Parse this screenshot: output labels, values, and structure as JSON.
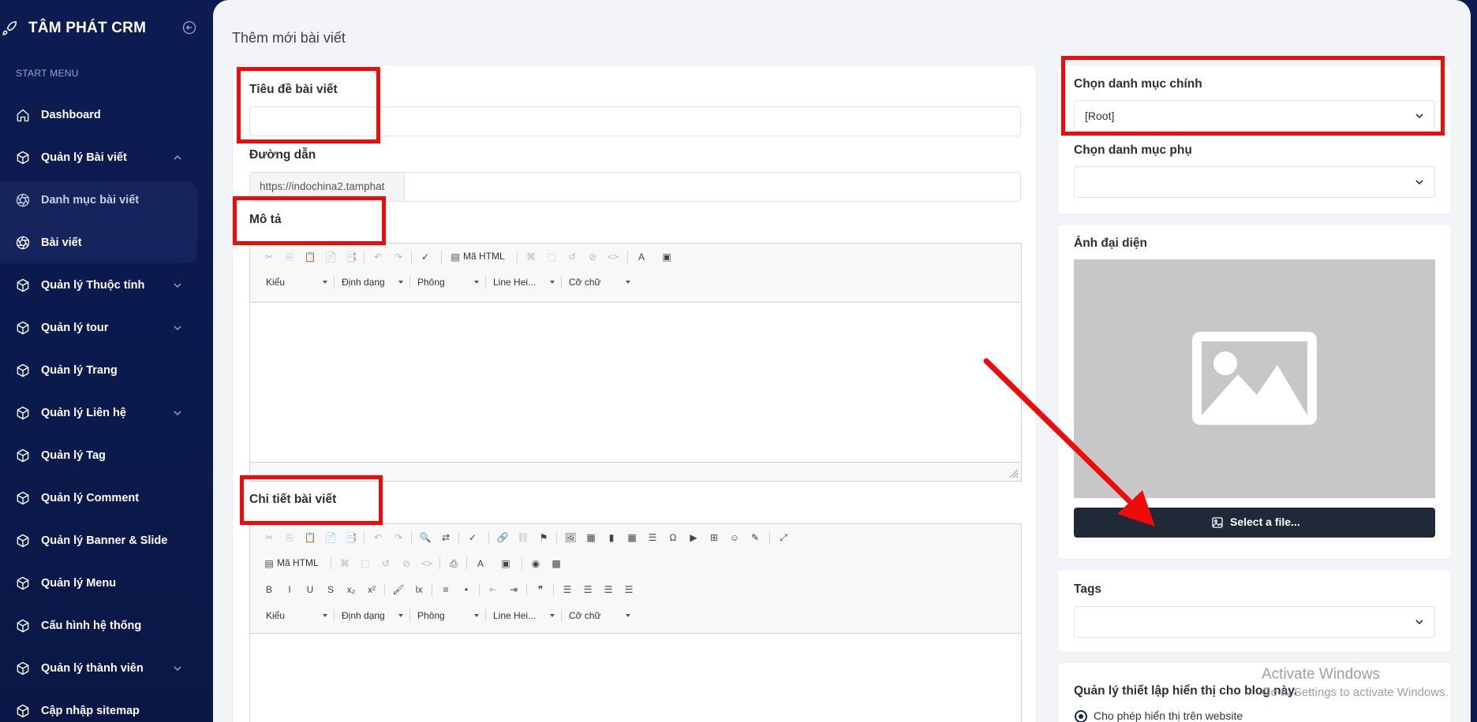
{
  "app": {
    "name": "TÂM PHÁT CRM"
  },
  "sidebar": {
    "section_label": "START MENU",
    "items": [
      {
        "label": "Dashboard",
        "icon": "home-icon",
        "has_chevron": false
      },
      {
        "label": "Quản lý Bài viết",
        "icon": "box-icon",
        "has_chevron": true,
        "expanded": true
      },
      {
        "label": "Danh mục bài viết",
        "icon": "aperture-icon",
        "sub": true
      },
      {
        "label": "Bài viết",
        "icon": "aperture-icon",
        "sub": true,
        "active": true
      },
      {
        "label": "Quản lý Thuộc tính",
        "icon": "box-icon",
        "has_chevron": true
      },
      {
        "label": "Quản lý tour",
        "icon": "box-icon",
        "has_chevron": true
      },
      {
        "label": "Quản lý Trang",
        "icon": "box-icon",
        "has_chevron": false
      },
      {
        "label": "Quản lý Liên hệ",
        "icon": "box-icon",
        "has_chevron": true
      },
      {
        "label": "Quản lý Tag",
        "icon": "box-icon",
        "has_chevron": false
      },
      {
        "label": "Quản lý Comment",
        "icon": "box-icon",
        "has_chevron": false
      },
      {
        "label": "Quản lý Banner & Slide",
        "icon": "box-icon",
        "has_chevron": false
      },
      {
        "label": "Quản lý Menu",
        "icon": "box-icon",
        "has_chevron": false
      },
      {
        "label": "Cấu hình hệ thống",
        "icon": "box-icon",
        "has_chevron": false
      },
      {
        "label": "Quản lý thành viên",
        "icon": "box-icon",
        "has_chevron": true
      },
      {
        "label": "Cập nhập sitemap",
        "icon": "box-icon",
        "has_chevron": false
      }
    ]
  },
  "page": {
    "title": "Thêm mới bài viết"
  },
  "form": {
    "title_label": "Tiêu đề bài viết",
    "title_value": "",
    "slug_label": "Đường dẫn",
    "slug_prefix": "https://indochina2.tamphat",
    "slug_value": "",
    "desc_label": "Mô tả",
    "detail_label": "Chi tiết bài viết"
  },
  "editor": {
    "source_label": "Mã HTML",
    "combos": [
      "Kiểu",
      "Định dạng",
      "Phông",
      "Line Hei...",
      "Cỡ chữ"
    ]
  },
  "right": {
    "main_cat_label": "Chọn danh mục chính",
    "main_cat_value": "[Root]",
    "sub_cat_label": "Chọn danh mục phụ",
    "sub_cat_value": "",
    "avatar_label": "Ảnh đại diện",
    "select_file": "Select a file...",
    "tags_label": "Tags",
    "tags_value": "",
    "display_label": "Quản lý thiết lập hiển thị cho blog này.",
    "display_option": "Cho phép hiển thị trên website"
  },
  "watermark": {
    "title": "Activate Windows",
    "subtitle": "Go to Settings to activate Windows."
  },
  "colors": {
    "sidebar": "#0c1a4f",
    "highlight": "#f00a0a",
    "button": "#1f2937"
  }
}
